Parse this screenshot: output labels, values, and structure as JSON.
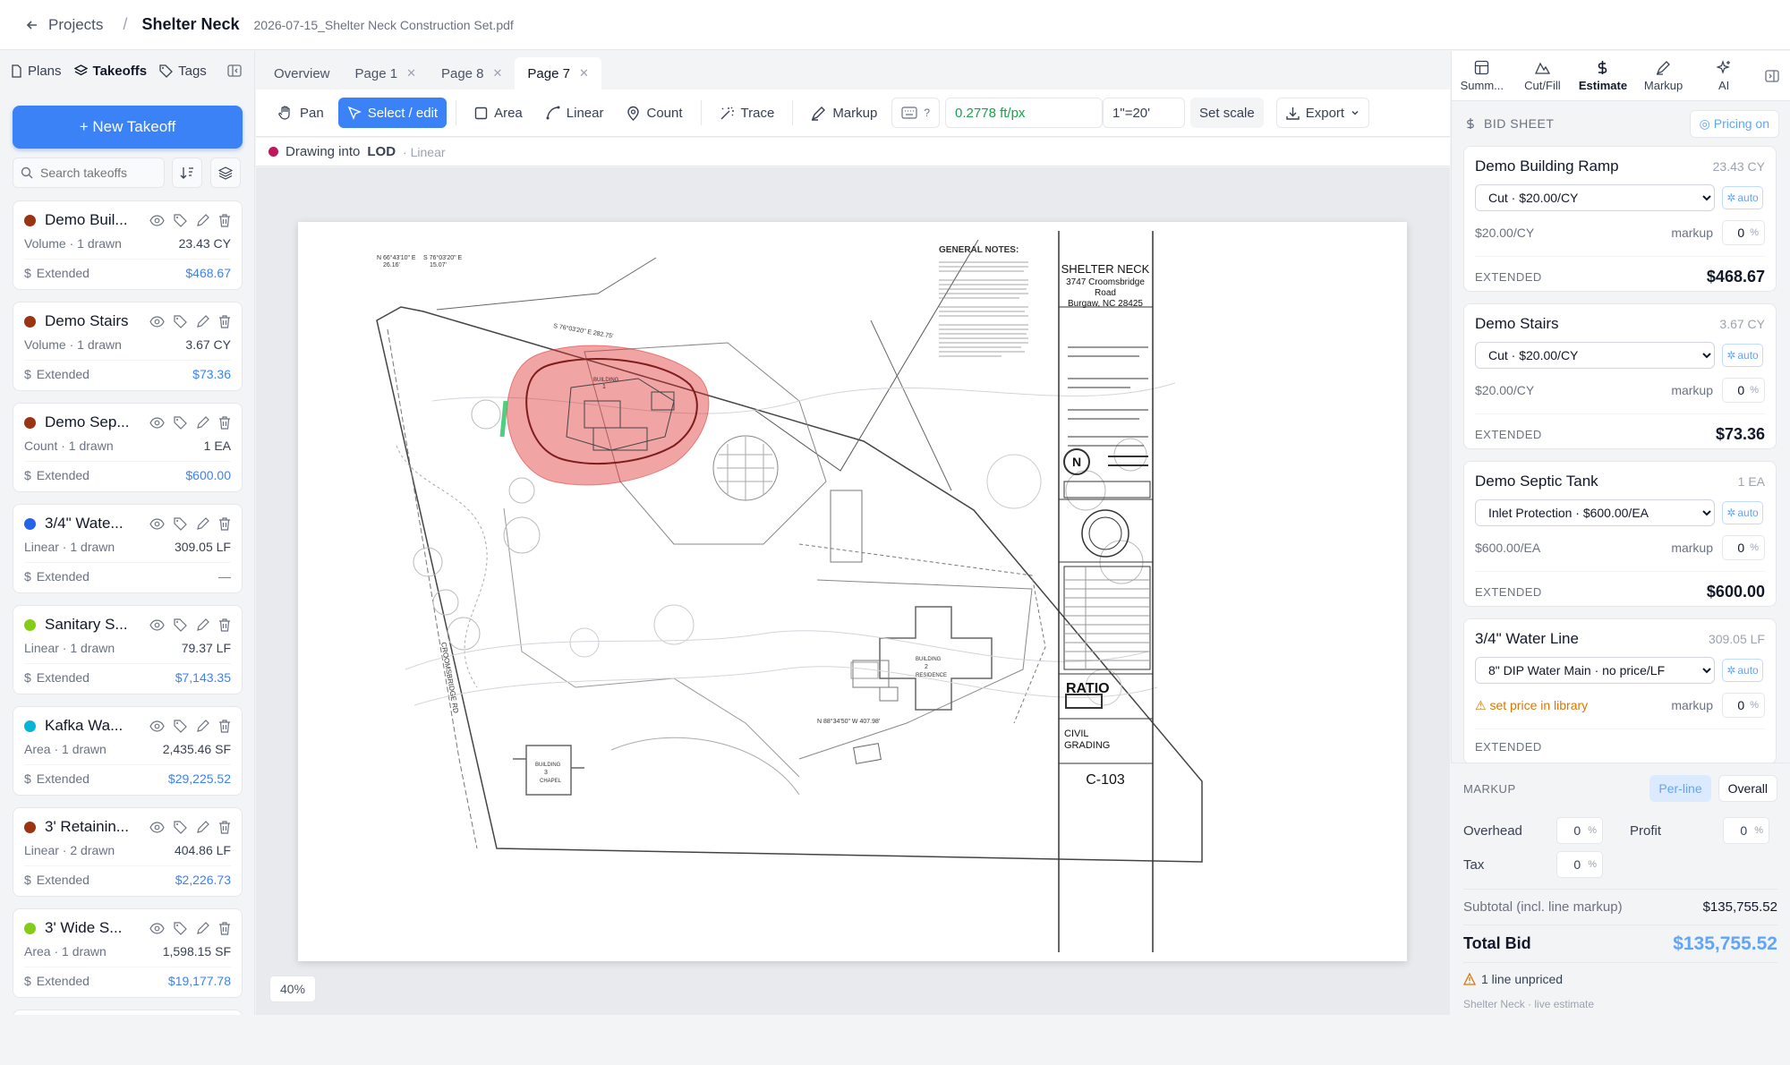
{
  "topbar": {
    "back_label": "Projects",
    "project": "Shelter Neck",
    "file": "2026-07-15_Shelter Neck Construction Set.pdf"
  },
  "left": {
    "tabs": [
      "Plans",
      "Takeoffs",
      "Tags"
    ],
    "new_takeoff": "+ New Takeoff",
    "search_placeholder": "Search takeoffs",
    "extended_label": "Extended",
    "takeoffs": [
      {
        "name": "Demo Buil...",
        "color": "#9a3412",
        "meta": "Volume · 1 drawn",
        "qty": "23.43 CY",
        "ext": "$468.67"
      },
      {
        "name": "Demo Stairs",
        "color": "#9a3412",
        "meta": "Volume · 1 drawn",
        "qty": "3.67 CY",
        "ext": "$73.36"
      },
      {
        "name": "Demo Sep...",
        "color": "#9a3412",
        "meta": "Count · 1 drawn",
        "qty": "1 EA",
        "ext": "$600.00"
      },
      {
        "name": "3/4\" Wate...",
        "color": "#2563eb",
        "meta": "Linear · 1 drawn",
        "qty": "309.05 LF",
        "ext": "—"
      },
      {
        "name": "Sanitary S...",
        "color": "#84cc16",
        "meta": "Linear · 1 drawn",
        "qty": "79.37 LF",
        "ext": "$7,143.35"
      },
      {
        "name": "Kafka Wa...",
        "color": "#06b6d4",
        "meta": "Area · 1 drawn",
        "qty": "2,435.46 SF",
        "ext": "$29,225.52"
      },
      {
        "name": "3' Retainin...",
        "color": "#9a3412",
        "meta": "Linear · 2 drawn",
        "qty": "404.86 LF",
        "ext": "$2,226.73"
      },
      {
        "name": "3' Wide S...",
        "color": "#84cc16",
        "meta": "Area · 1 drawn",
        "qty": "1,598.15 SF",
        "ext": "$19,177.78"
      }
    ]
  },
  "doc_tabs": [
    "Overview",
    "Page 1",
    "Page 8",
    "Page 7"
  ],
  "toolbar": {
    "pan": "Pan",
    "select": "Select / edit",
    "area": "Area",
    "linear": "Linear",
    "count": "Count",
    "trace": "Trace",
    "markup": "Markup",
    "help": "?",
    "scale_px": "0.2778 ft/px",
    "scale_value": "1\"=20'",
    "set_scale": "Set scale",
    "export": "Export"
  },
  "status": {
    "prefix": "Drawing into",
    "layer": "LOD",
    "mode": "· Linear",
    "color": "#be185d"
  },
  "zoom": "40%",
  "sheet": {
    "notes_title": "GENERAL NOTES:",
    "project_name": "SHELTER NECK",
    "address1": "3747 Croomsbridge",
    "address2": "Road",
    "address3": "Burgaw, NC  28425",
    "firm": "RATIO",
    "sheet_title1": "CIVIL",
    "sheet_title2": "GRADING",
    "sheet_number": "C-103",
    "road_label": "CROOMSBRIDGE RD",
    "bearing1": "N 66°43'10\" E",
    "bearing1b": "26.16'",
    "bearing2": "S 76°03'20\" E",
    "bearing2b": "15.07'",
    "bearing3": "S 76°03'20\" E  282.75'",
    "bearing4": "N 88°34'50\" W  407.98'",
    "bldg1": "BUILDING",
    "bldg1n": "1",
    "bldg2": "BUILDING",
    "bldg2n": "2",
    "bldg2s": "RESIDENCE",
    "bldg3": "BUILDING",
    "bldg3n": "3",
    "bldg3s": "CHAPEL"
  },
  "right": {
    "tabs": [
      "Summ...",
      "Cut/Fill",
      "Estimate",
      "Markup",
      "AI"
    ],
    "bid_header": "BID SHEET",
    "pricing": "Pricing on",
    "markup_label": "markup",
    "extended_label": "EXTENDED",
    "auto": "auto",
    "items": [
      {
        "name": "Demo Building Ramp",
        "qty": "23.43 CY",
        "option": "Cut · $20.00/CY",
        "unit": "$20.00/CY",
        "markup": "0",
        "ext": "$468.67"
      },
      {
        "name": "Demo Stairs",
        "qty": "3.67 CY",
        "option": "Cut · $20.00/CY",
        "unit": "$20.00/CY",
        "markup": "0",
        "ext": "$73.36"
      },
      {
        "name": "Demo Septic Tank",
        "qty": "1 EA",
        "option": "Inlet Protection · $600.00/EA",
        "unit": "$600.00/EA",
        "markup": "0",
        "ext": "$600.00"
      },
      {
        "name": "3/4\" Water Line",
        "qty": "309.05 LF",
        "option": "8\" DIP Water Main · no price/LF",
        "unit": "set price in library",
        "markup": "0",
        "ext": ""
      }
    ],
    "markup_section": {
      "title": "MARKUP",
      "per_line": "Per-line",
      "overall": "Overall",
      "overhead": "Overhead",
      "overhead_val": "0",
      "profit": "Profit",
      "profit_val": "0",
      "tax": "Tax",
      "tax_val": "0",
      "pct": "%"
    },
    "subtotal_label": "Subtotal (incl. line markup)",
    "subtotal": "$135,755.52",
    "total_label": "Total Bid",
    "total": "$135,755.52",
    "unpriced": "1 line unpriced",
    "footer": "Shelter Neck · live estimate"
  }
}
